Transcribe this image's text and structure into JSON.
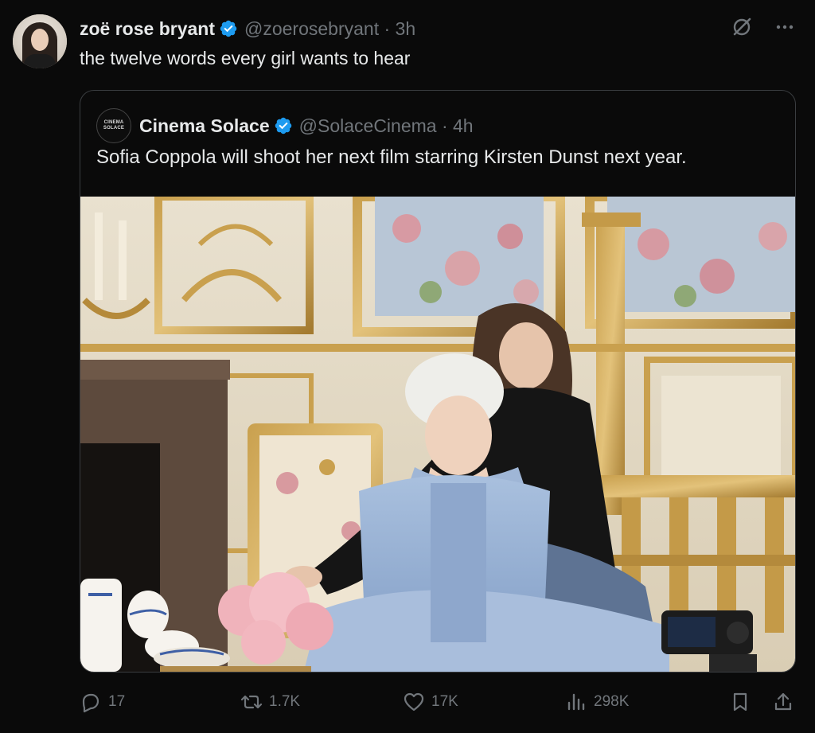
{
  "author": {
    "display_name": "zoë rose bryant",
    "handle_time": "@zoerosebryant · 3h",
    "avatar_icon": "profile-photo"
  },
  "tweet": {
    "text": "the twelve words every girl wants to hear"
  },
  "quote": {
    "avatar_lines": [
      "CINEMA",
      "SOLACE"
    ],
    "display_name": "Cinema Solace",
    "handle_time": "@SolaceCinema · 4h",
    "text": "Sofia Coppola will shoot her next film starring Kirsten Dunst next year."
  },
  "actions": {
    "replies": "17",
    "reposts": "1.7K",
    "likes": "17K",
    "views": "298K"
  },
  "colors": {
    "background": "#0a0a0a",
    "text": "#e7e9ea",
    "muted": "#71767b",
    "verified": "#1d9bf0",
    "border": "#3a3d40"
  }
}
